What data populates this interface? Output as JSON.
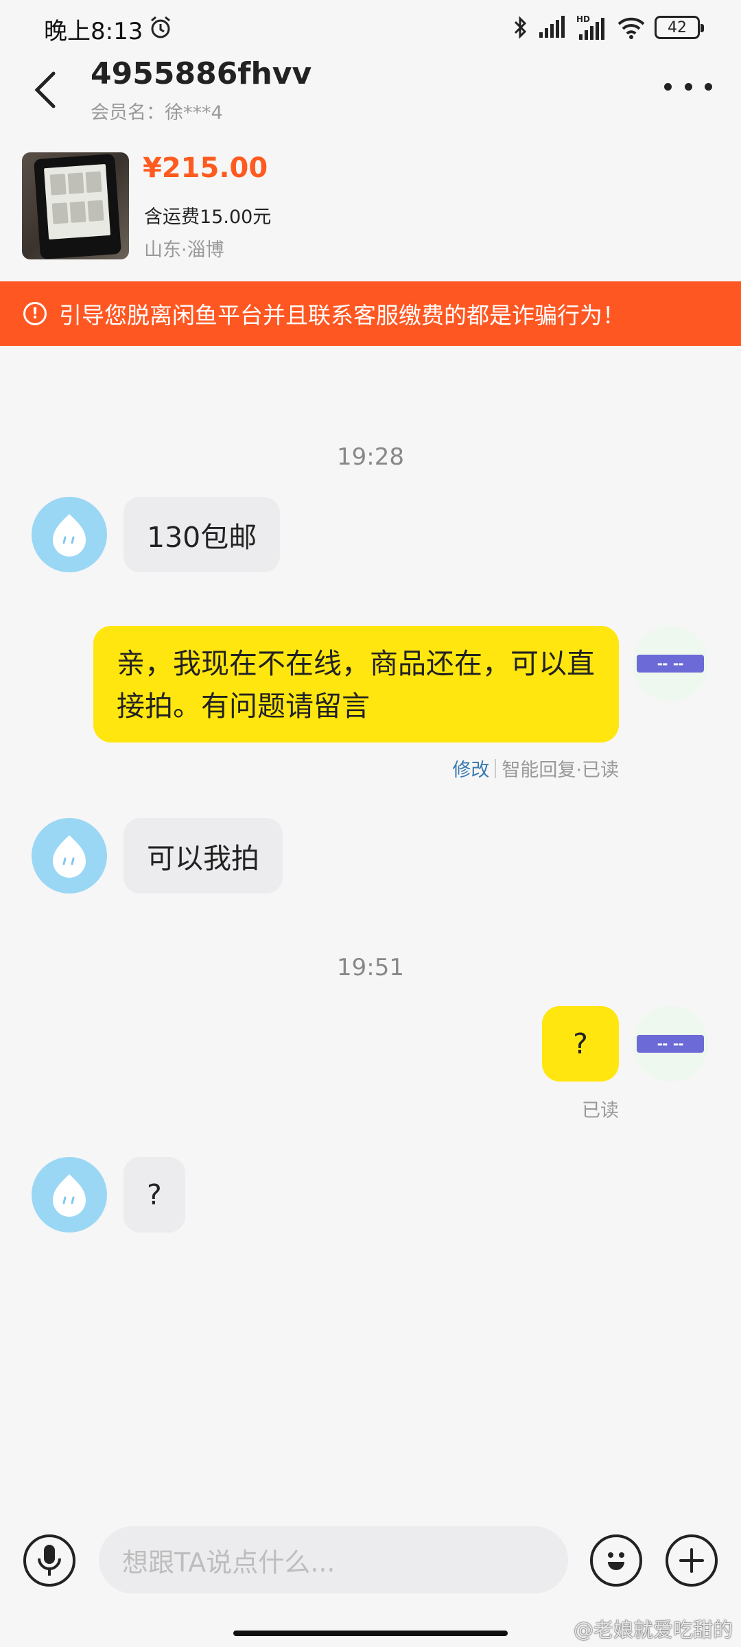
{
  "status_bar": {
    "time": "晚上8:13",
    "battery": "42"
  },
  "header": {
    "title": "4955886fhvv",
    "subtitle": "会员名：徐***4"
  },
  "product": {
    "price": "¥215.00",
    "shipping": "含运费15.00元",
    "location": "山东·淄博"
  },
  "warning": {
    "icon": "!",
    "text": "引导您脱离闲鱼平台并且联系客服缴费的都是诈骗行为！"
  },
  "messages": {
    "t1": "19:28",
    "m1": "130包邮",
    "m2": "亲，我现在不在线，商品还在，可以直接拍。有问题请留言",
    "m2_edit": "修改",
    "m2_status": "智能回复·已读",
    "m3": "可以我拍",
    "t2": "19:51",
    "m4": "?",
    "m4_status": "已读",
    "m5": "?"
  },
  "input": {
    "placeholder": "想跟TA说点什么..."
  },
  "watermark": "@老娘就爱吃甜的",
  "colors": {
    "accent": "#ff5722",
    "price": "#ff5a1f",
    "my_bubble": "#ffe60f",
    "avatar": "#9ad7f5"
  }
}
